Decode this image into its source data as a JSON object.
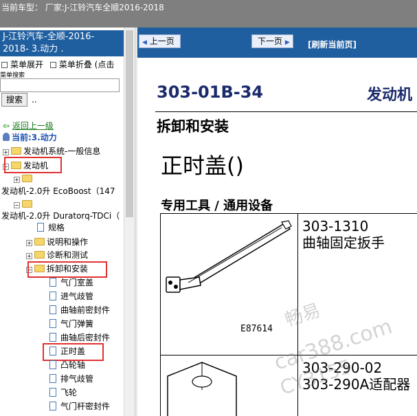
{
  "top_bar": {
    "text": "当前车型： 厂家:J-江铃汽车全顺2016-2018"
  },
  "left_panel": {
    "title_line1": "J-江铃汽车-全顺-2016-",
    "title_line2": "2018- 3.动力 .",
    "menu_expand": "菜单展开",
    "menu_collapse": "菜单折叠 (点击",
    "search_label": "菜单搜索",
    "search_value": "",
    "search_button": "搜索",
    "search_dots": "..",
    "back_link": "返回上一级",
    "current_label": "当前:3.动力",
    "tree": [
      {
        "label": "发动机系统-一般信息"
      },
      {
        "label": "发动机"
      },
      {
        "label": ""
      },
      {
        "label": "发动机-2.0升 EcoBoost（147"
      },
      {
        "label": ""
      },
      {
        "label": "发动机-2.0升 Duratorq-TDCi（"
      },
      {
        "label": "规格"
      },
      {
        "label": "说明和操作"
      },
      {
        "label": "诊断和测试"
      },
      {
        "label": "拆卸和安装"
      },
      {
        "label": "气门室盖"
      },
      {
        "label": "进气歧管"
      },
      {
        "label": "曲轴前密封件"
      },
      {
        "label": "气门弹簧"
      },
      {
        "label": "曲轴后密封件"
      },
      {
        "label": "正时盖"
      },
      {
        "label": "凸轮轴"
      },
      {
        "label": "排气歧管"
      },
      {
        "label": "飞轮"
      },
      {
        "label": "气门杆密封件"
      }
    ]
  },
  "nav": {
    "prev": "上一页",
    "next": "下一页",
    "refresh": "[刷新当前页]"
  },
  "document": {
    "code": "303-01B-34",
    "category": "发动机",
    "section": "拆卸和安装",
    "title": "正时盖()",
    "tools_heading": "专用工具 / 通用设备",
    "tools": [
      {
        "code": "303-1310",
        "name": "曲轴固定扳手",
        "image_code": "E87614"
      },
      {
        "code": "303-290-02",
        "name": "303-290A适配器"
      }
    ]
  },
  "watermark": {
    "line1": "畅易",
    "line2": "car388.com",
    "line3": "CY3155"
  },
  "colors": {
    "top_bar": "#7f7f7f",
    "panel_blue": "#1f5fa0",
    "highlight_red": "#e03030",
    "doc_heading": "#1a2a6b"
  }
}
